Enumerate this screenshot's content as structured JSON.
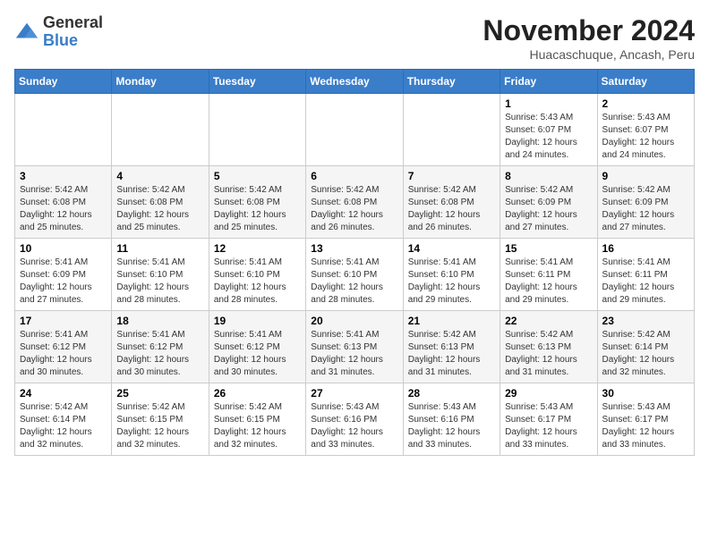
{
  "logo": {
    "general": "General",
    "blue": "Blue"
  },
  "title": "November 2024",
  "subtitle": "Huacaschuque, Ancash, Peru",
  "days_of_week": [
    "Sunday",
    "Monday",
    "Tuesday",
    "Wednesday",
    "Thursday",
    "Friday",
    "Saturday"
  ],
  "weeks": [
    [
      {
        "day": "",
        "info": ""
      },
      {
        "day": "",
        "info": ""
      },
      {
        "day": "",
        "info": ""
      },
      {
        "day": "",
        "info": ""
      },
      {
        "day": "",
        "info": ""
      },
      {
        "day": "1",
        "info": "Sunrise: 5:43 AM\nSunset: 6:07 PM\nDaylight: 12 hours and 24 minutes."
      },
      {
        "day": "2",
        "info": "Sunrise: 5:43 AM\nSunset: 6:07 PM\nDaylight: 12 hours and 24 minutes."
      }
    ],
    [
      {
        "day": "3",
        "info": "Sunrise: 5:42 AM\nSunset: 6:08 PM\nDaylight: 12 hours and 25 minutes."
      },
      {
        "day": "4",
        "info": "Sunrise: 5:42 AM\nSunset: 6:08 PM\nDaylight: 12 hours and 25 minutes."
      },
      {
        "day": "5",
        "info": "Sunrise: 5:42 AM\nSunset: 6:08 PM\nDaylight: 12 hours and 25 minutes."
      },
      {
        "day": "6",
        "info": "Sunrise: 5:42 AM\nSunset: 6:08 PM\nDaylight: 12 hours and 26 minutes."
      },
      {
        "day": "7",
        "info": "Sunrise: 5:42 AM\nSunset: 6:08 PM\nDaylight: 12 hours and 26 minutes."
      },
      {
        "day": "8",
        "info": "Sunrise: 5:42 AM\nSunset: 6:09 PM\nDaylight: 12 hours and 27 minutes."
      },
      {
        "day": "9",
        "info": "Sunrise: 5:42 AM\nSunset: 6:09 PM\nDaylight: 12 hours and 27 minutes."
      }
    ],
    [
      {
        "day": "10",
        "info": "Sunrise: 5:41 AM\nSunset: 6:09 PM\nDaylight: 12 hours and 27 minutes."
      },
      {
        "day": "11",
        "info": "Sunrise: 5:41 AM\nSunset: 6:10 PM\nDaylight: 12 hours and 28 minutes."
      },
      {
        "day": "12",
        "info": "Sunrise: 5:41 AM\nSunset: 6:10 PM\nDaylight: 12 hours and 28 minutes."
      },
      {
        "day": "13",
        "info": "Sunrise: 5:41 AM\nSunset: 6:10 PM\nDaylight: 12 hours and 28 minutes."
      },
      {
        "day": "14",
        "info": "Sunrise: 5:41 AM\nSunset: 6:10 PM\nDaylight: 12 hours and 29 minutes."
      },
      {
        "day": "15",
        "info": "Sunrise: 5:41 AM\nSunset: 6:11 PM\nDaylight: 12 hours and 29 minutes."
      },
      {
        "day": "16",
        "info": "Sunrise: 5:41 AM\nSunset: 6:11 PM\nDaylight: 12 hours and 29 minutes."
      }
    ],
    [
      {
        "day": "17",
        "info": "Sunrise: 5:41 AM\nSunset: 6:12 PM\nDaylight: 12 hours and 30 minutes."
      },
      {
        "day": "18",
        "info": "Sunrise: 5:41 AM\nSunset: 6:12 PM\nDaylight: 12 hours and 30 minutes."
      },
      {
        "day": "19",
        "info": "Sunrise: 5:41 AM\nSunset: 6:12 PM\nDaylight: 12 hours and 30 minutes."
      },
      {
        "day": "20",
        "info": "Sunrise: 5:41 AM\nSunset: 6:13 PM\nDaylight: 12 hours and 31 minutes."
      },
      {
        "day": "21",
        "info": "Sunrise: 5:42 AM\nSunset: 6:13 PM\nDaylight: 12 hours and 31 minutes."
      },
      {
        "day": "22",
        "info": "Sunrise: 5:42 AM\nSunset: 6:13 PM\nDaylight: 12 hours and 31 minutes."
      },
      {
        "day": "23",
        "info": "Sunrise: 5:42 AM\nSunset: 6:14 PM\nDaylight: 12 hours and 32 minutes."
      }
    ],
    [
      {
        "day": "24",
        "info": "Sunrise: 5:42 AM\nSunset: 6:14 PM\nDaylight: 12 hours and 32 minutes."
      },
      {
        "day": "25",
        "info": "Sunrise: 5:42 AM\nSunset: 6:15 PM\nDaylight: 12 hours and 32 minutes."
      },
      {
        "day": "26",
        "info": "Sunrise: 5:42 AM\nSunset: 6:15 PM\nDaylight: 12 hours and 32 minutes."
      },
      {
        "day": "27",
        "info": "Sunrise: 5:43 AM\nSunset: 6:16 PM\nDaylight: 12 hours and 33 minutes."
      },
      {
        "day": "28",
        "info": "Sunrise: 5:43 AM\nSunset: 6:16 PM\nDaylight: 12 hours and 33 minutes."
      },
      {
        "day": "29",
        "info": "Sunrise: 5:43 AM\nSunset: 6:17 PM\nDaylight: 12 hours and 33 minutes."
      },
      {
        "day": "30",
        "info": "Sunrise: 5:43 AM\nSunset: 6:17 PM\nDaylight: 12 hours and 33 minutes."
      }
    ]
  ]
}
